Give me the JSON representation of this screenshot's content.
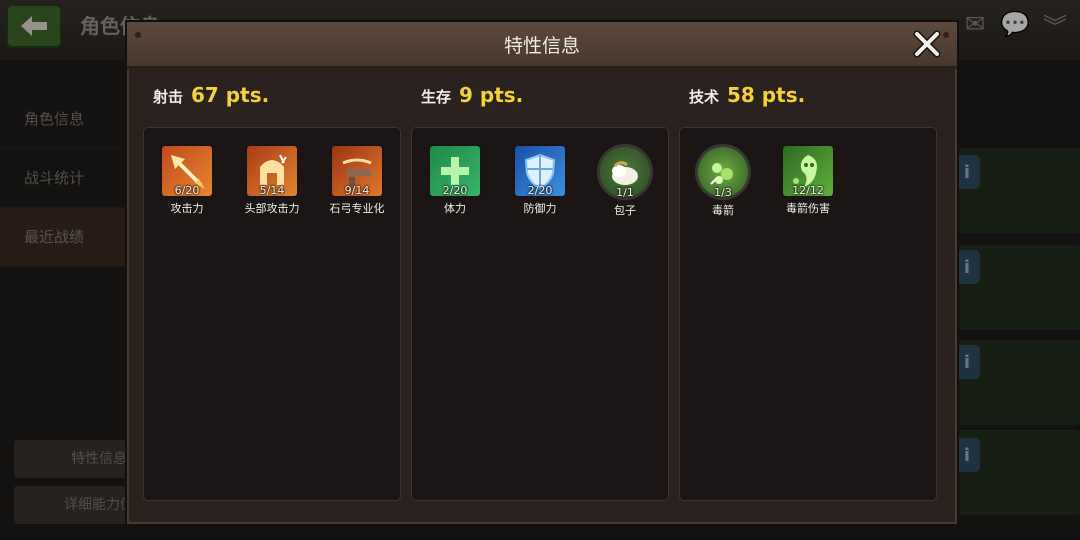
{
  "background": {
    "title": "角色信息",
    "sidebar": [
      "角色信息",
      "战斗统计",
      "最近战绩"
    ],
    "buttons": [
      "特性信息",
      "详细能力值"
    ]
  },
  "modal": {
    "title": "特性信息",
    "columns": [
      {
        "name": "射击",
        "pts": "67 pts.",
        "skills": [
          {
            "level": "6/20",
            "name": "攻击力",
            "icon": "arrow-icon"
          },
          {
            "level": "5/14",
            "name": "头部攻击力",
            "icon": "helmet-icon"
          },
          {
            "level": "9/14",
            "name": "石弓专业化",
            "icon": "crossbow-icon"
          }
        ]
      },
      {
        "name": "生存",
        "pts": "9 pts.",
        "skills": [
          {
            "level": "2/20",
            "name": "体力",
            "icon": "health-cross-icon"
          },
          {
            "level": "2/20",
            "name": "防御力",
            "icon": "shield-icon"
          },
          {
            "level": "1/1",
            "name": "包子",
            "icon": "bun-icon"
          }
        ]
      },
      {
        "name": "技术",
        "pts": "58 pts.",
        "skills": [
          {
            "level": "1/3",
            "name": "毒箭",
            "icon": "poison-arrow-icon"
          },
          {
            "level": "12/12",
            "name": "毒箭伤害",
            "icon": "poison-ghost-icon"
          }
        ]
      }
    ]
  },
  "colors": {
    "accent_points": "#f4d23a",
    "header": "#5e4a3c"
  }
}
